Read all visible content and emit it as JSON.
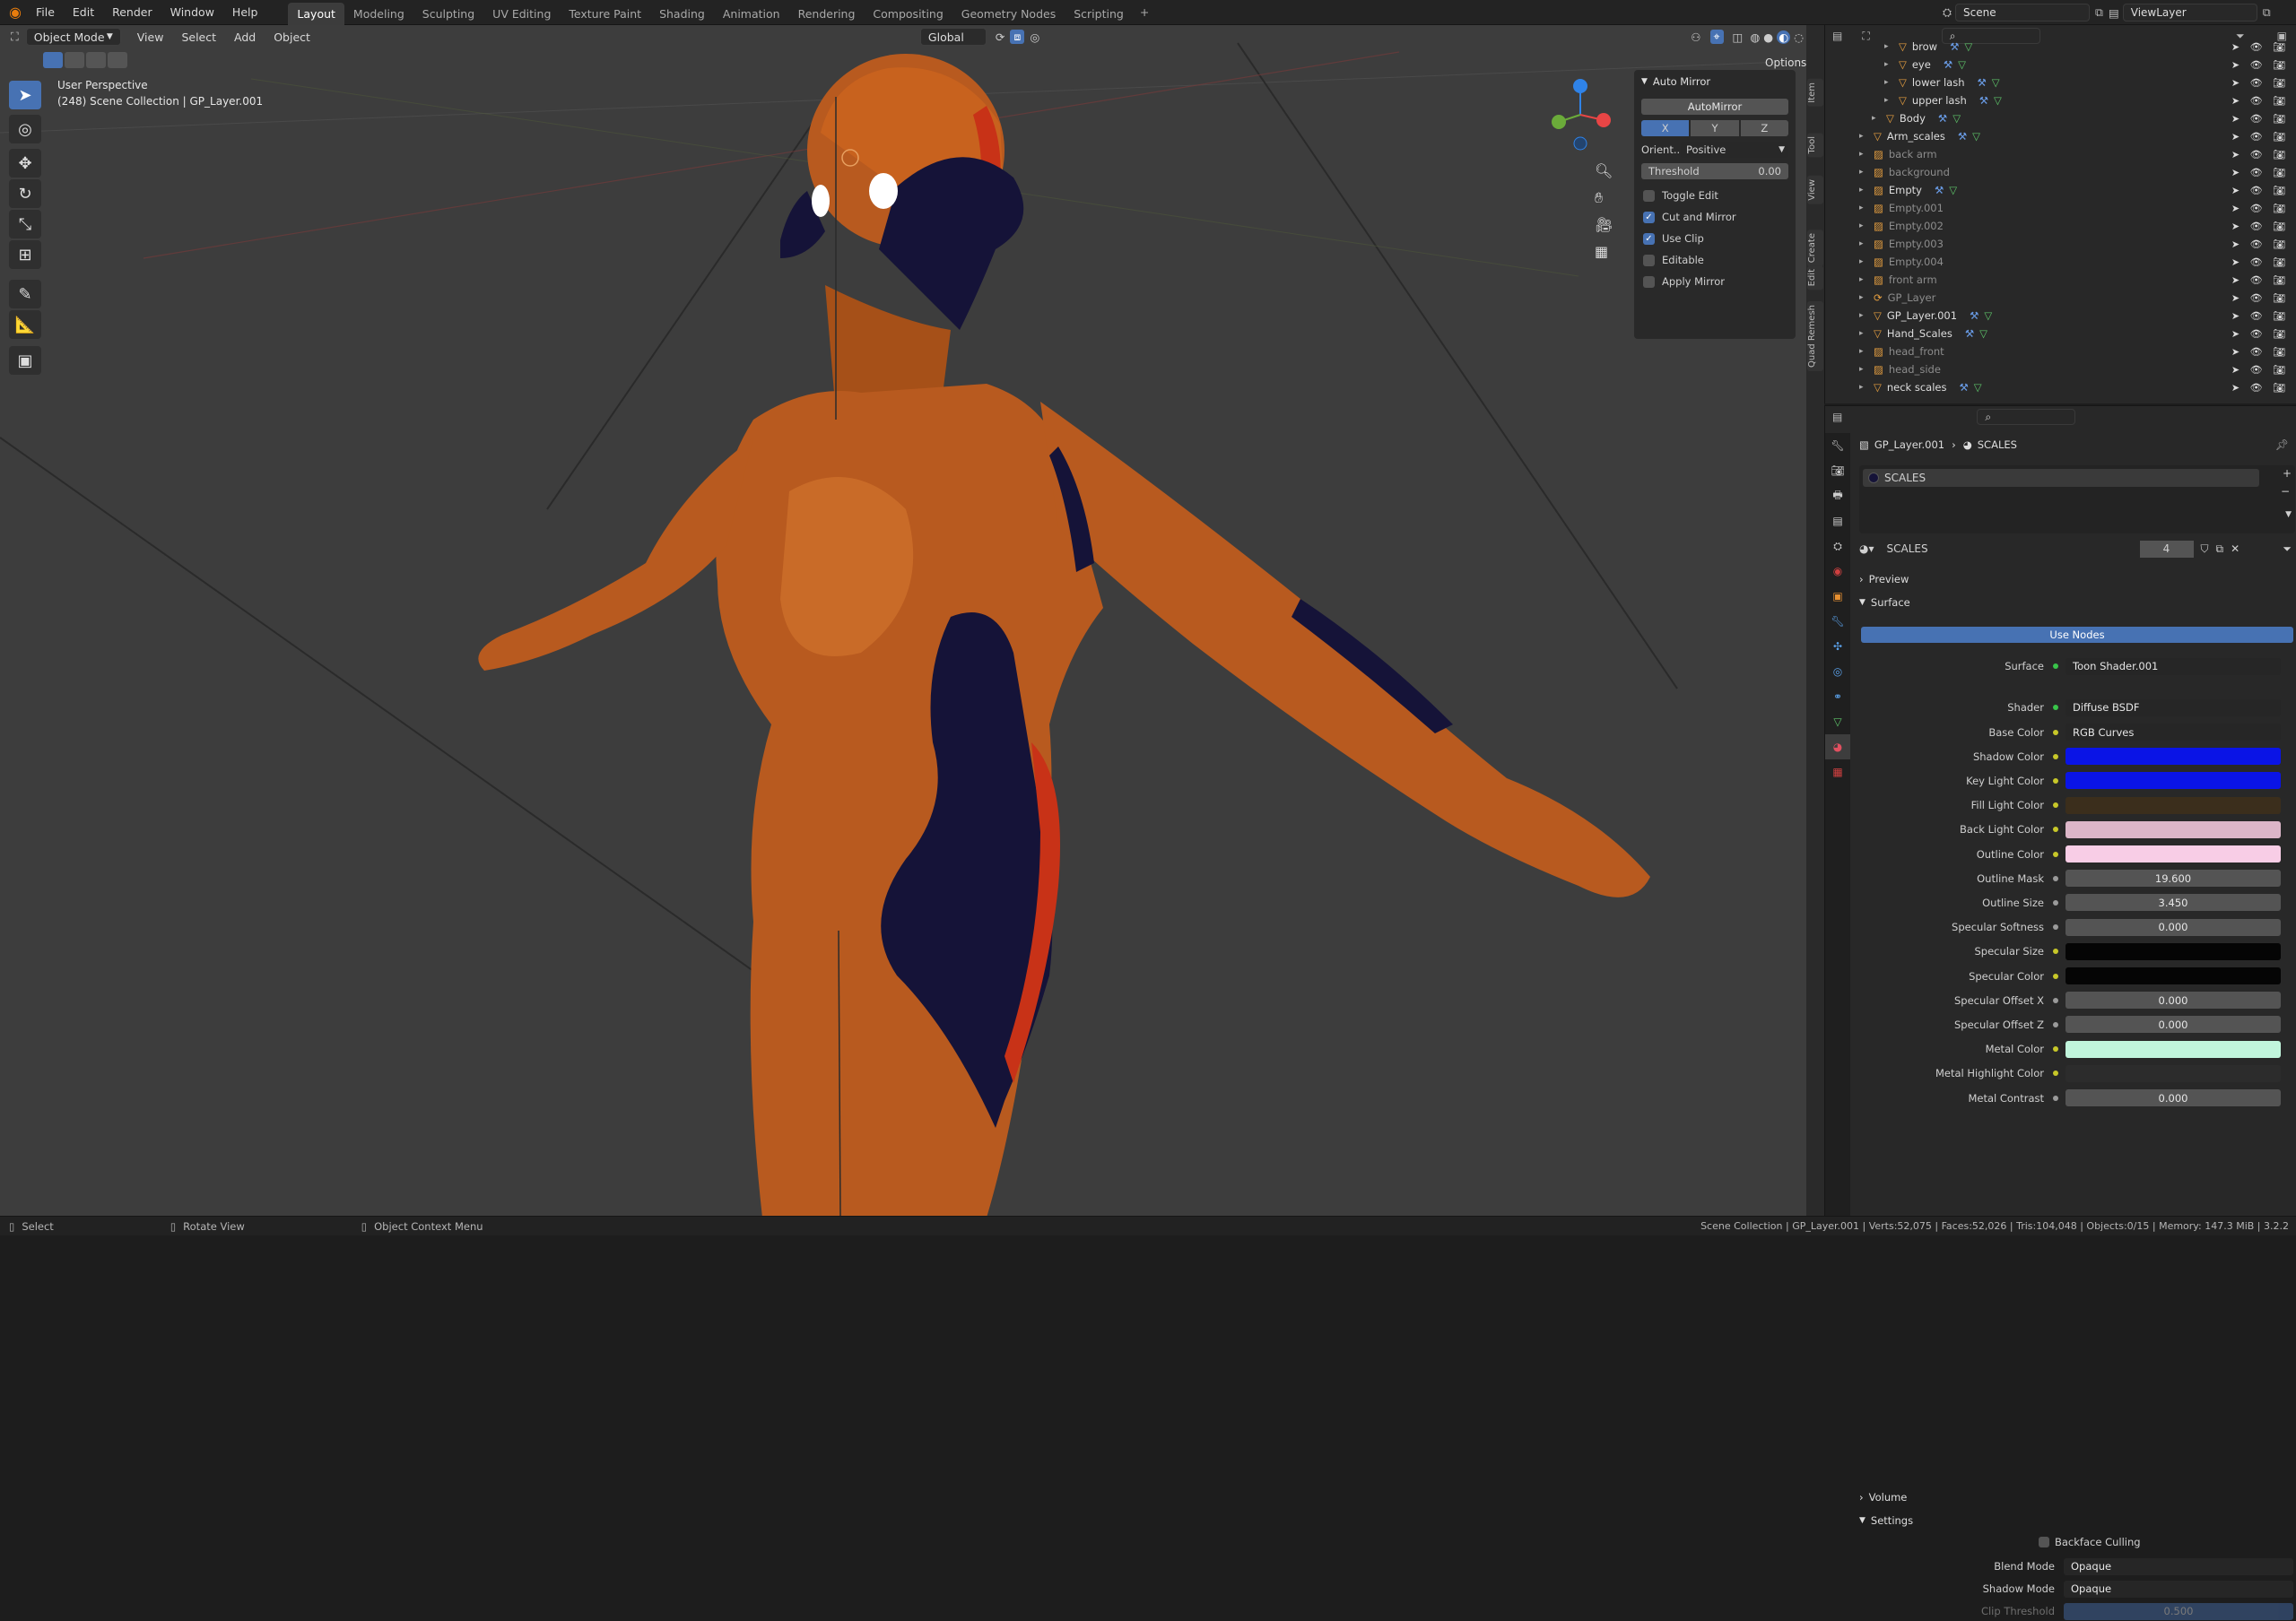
{
  "app": {
    "logo": "blender-icon"
  },
  "menu": [
    "File",
    "Edit",
    "Render",
    "Window",
    "Help"
  ],
  "workspaces": [
    "Layout",
    "Modeling",
    "Sculpting",
    "UV Editing",
    "Texture Paint",
    "Shading",
    "Animation",
    "Rendering",
    "Compositing",
    "Geometry Nodes",
    "Scripting"
  ],
  "active_workspace": "Layout",
  "scene": "Scene",
  "view_layer": "ViewLayer",
  "viewport": {
    "mode": "Object Mode",
    "menus": [
      "View",
      "Select",
      "Add",
      "Object"
    ],
    "transform_orientation": "Global",
    "perspective": "User Perspective",
    "collection_info": "(248) Scene Collection | GP_Layer.001",
    "options_label": "Options"
  },
  "auto_mirror": {
    "title": "Auto Mirror",
    "button": "AutoMirror",
    "axes": [
      "X",
      "Y",
      "Z"
    ],
    "active_axis": "X",
    "orient_label": "Orient...",
    "orient_value": "Positive",
    "threshold_label": "Threshold",
    "threshold_value": "0.00",
    "checks": [
      {
        "label": "Toggle Edit",
        "checked": false
      },
      {
        "label": "Cut and Mirror",
        "checked": true
      },
      {
        "label": "Use Clip",
        "checked": true
      },
      {
        "label": "Editable",
        "checked": false
      },
      {
        "label": "Apply Mirror",
        "checked": false
      }
    ]
  },
  "side_tabs": [
    "Item",
    "Tool",
    "View",
    "Create",
    "Edit",
    "Quad Remesh"
  ],
  "outliner": {
    "rows": [
      {
        "name": "brow",
        "indent": 4,
        "dim": false
      },
      {
        "name": "eye",
        "indent": 4,
        "dim": false
      },
      {
        "name": "lower lash",
        "indent": 4,
        "dim": false
      },
      {
        "name": "upper lash",
        "indent": 4,
        "dim": false
      },
      {
        "name": "Body",
        "indent": 3,
        "dim": false
      },
      {
        "name": "Arm_scales",
        "indent": 2,
        "dim": false
      },
      {
        "name": "back arm",
        "indent": 2,
        "dim": true
      },
      {
        "name": "background",
        "indent": 2,
        "dim": true
      },
      {
        "name": "Empty",
        "indent": 2,
        "dim": false
      },
      {
        "name": "Empty.001",
        "indent": 2,
        "dim": true
      },
      {
        "name": "Empty.002",
        "indent": 2,
        "dim": true
      },
      {
        "name": "Empty.003",
        "indent": 2,
        "dim": true
      },
      {
        "name": "Empty.004",
        "indent": 2,
        "dim": true
      },
      {
        "name": "front arm",
        "indent": 2,
        "dim": true
      },
      {
        "name": "GP_Layer",
        "indent": 2,
        "dim": true
      },
      {
        "name": "GP_Layer.001",
        "indent": 2,
        "dim": false
      },
      {
        "name": "Hand_Scales",
        "indent": 2,
        "dim": false
      },
      {
        "name": "head_front",
        "indent": 2,
        "dim": true
      },
      {
        "name": "head_side",
        "indent": 2,
        "dim": true
      },
      {
        "name": "neck scales",
        "indent": 2,
        "dim": false
      }
    ]
  },
  "properties": {
    "breadcrumb": [
      "GP_Layer.001",
      "SCALES"
    ],
    "slot": "SCALES",
    "material_name": "SCALES",
    "users": "4",
    "sections": {
      "preview": "Preview",
      "surface": "Surface",
      "volume": "Volume",
      "settings": "Settings"
    },
    "use_nodes": "Use Nodes",
    "surface_rows": [
      {
        "label": "Surface",
        "value": "Toon Shader.001",
        "kind": "link",
        "dot": "gr"
      },
      {
        "label": "Shader",
        "value": "Diffuse BSDF",
        "kind": "link",
        "dot": "gr"
      },
      {
        "label": "Base Color",
        "value": "RGB Curves",
        "kind": "link",
        "dot": "y"
      },
      {
        "label": "Shadow Color",
        "value": "",
        "kind": "color",
        "color": "#0a14e6",
        "dot": "y"
      },
      {
        "label": "Key Light Color",
        "value": "",
        "kind": "color",
        "color": "#0a14e6",
        "dot": "y"
      },
      {
        "label": "Fill Light Color",
        "value": "",
        "kind": "color",
        "color": "#3b2e1c",
        "dot": "y"
      },
      {
        "label": "Back Light Color",
        "value": "",
        "kind": "color",
        "color": "#dcb6c8",
        "dot": "y"
      },
      {
        "label": "Outline Color",
        "value": "",
        "kind": "color",
        "color": "#f8cde6",
        "dot": "y"
      },
      {
        "label": "Outline Mask",
        "value": "19.600",
        "kind": "num",
        "dot": "g"
      },
      {
        "label": "Outline Size",
        "value": "3.450",
        "kind": "num",
        "dot": "g"
      },
      {
        "label": "Specular Softness",
        "value": "0.000",
        "kind": "num",
        "dot": "g"
      },
      {
        "label": "Specular Size",
        "value": "",
        "kind": "color",
        "color": "#050505",
        "dot": "y"
      },
      {
        "label": "Specular Color",
        "value": "",
        "kind": "color",
        "color": "#050505",
        "dot": "y"
      },
      {
        "label": "Specular Offset X",
        "value": "0.000",
        "kind": "num",
        "dot": "g"
      },
      {
        "label": "Specular Offset Z",
        "value": "0.000",
        "kind": "num",
        "dot": "g"
      },
      {
        "label": "Metal Color",
        "value": "",
        "kind": "color",
        "color": "#c1f5dc",
        "dot": "y"
      },
      {
        "label": "Metal Highlight Color",
        "value": "",
        "kind": "color",
        "color": "#2c2c2c",
        "dot": "y"
      },
      {
        "label": "Metal Contrast",
        "value": "0.000",
        "kind": "num",
        "dot": "g"
      }
    ],
    "settings_rows": {
      "backface": "Backface Culling",
      "blend_label": "Blend Mode",
      "blend_value": "Opaque",
      "shadow_label": "Shadow Mode",
      "shadow_value": "Opaque",
      "clip_label": "Clip Threshold",
      "clip_value": "0.500"
    }
  },
  "status": {
    "left": [
      "Select",
      "Rotate View",
      "Object Context Menu"
    ],
    "right": "Scene Collection | GP_Layer.001 | Verts:52,075 | Faces:52,026 | Tris:104,048 | Objects:0/15 | Memory: 147.3 MiB | 3.2.2"
  }
}
